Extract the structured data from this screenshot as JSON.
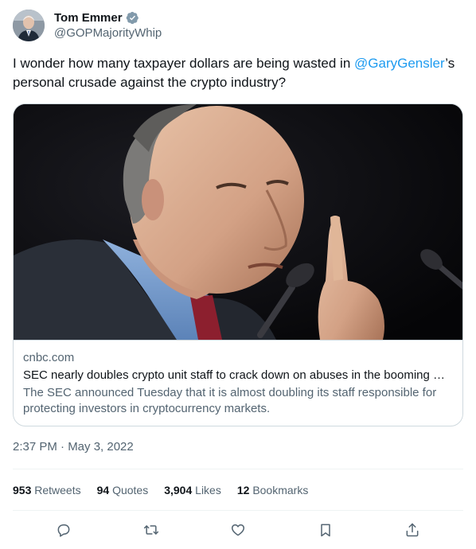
{
  "author": {
    "display_name": "Tom Emmer",
    "handle": "@GOPMajorityWhip",
    "verified_icon": "verified-badge-icon",
    "verified_color": "#829aab"
  },
  "tweet": {
    "text_before": "I wonder how many taxpayer dollars are being wasted in ",
    "mention": "@GaryGensler",
    "text_after": "’s personal crusade against the crypto industry?"
  },
  "card": {
    "domain": "cnbc.com",
    "title": "SEC nearly doubles crypto unit staff to crack down on abuses in the booming market",
    "description": "The SEC announced Tuesday that it is almost doubling its staff responsible for protecting investors in cryptocurrency markets."
  },
  "timestamp": "2:37 PM · May 3, 2022",
  "stats": {
    "retweets_count": "953",
    "retweets_label": "Retweets",
    "quotes_count": "94",
    "quotes_label": "Quotes",
    "likes_count": "3,904",
    "likes_label": "Likes",
    "bookmarks_count": "12",
    "bookmarks_label": "Bookmarks"
  },
  "actions": [
    "reply-icon",
    "retweet-icon",
    "like-icon",
    "bookmark-icon",
    "share-icon"
  ],
  "colors": {
    "link": "#1d9bf0",
    "secondary_text": "#536471",
    "border": "#cfd9de"
  }
}
